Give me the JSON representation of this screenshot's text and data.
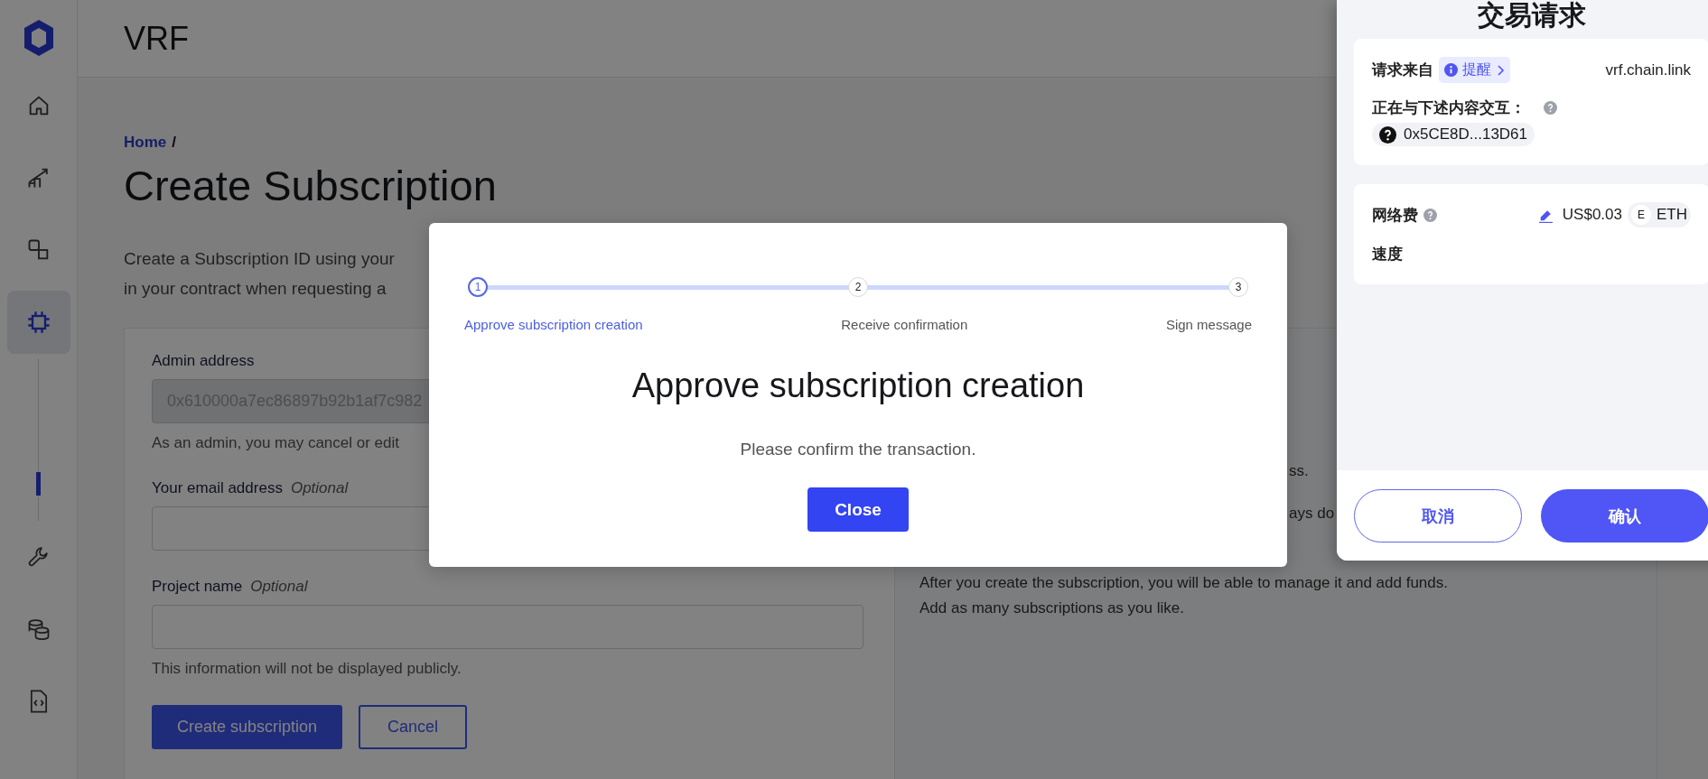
{
  "sidebar": {
    "items": [
      {
        "selected": false
      },
      {
        "selected": false
      },
      {
        "selected": false
      },
      {
        "selected": true
      },
      {
        "selected": false
      },
      {
        "selected": false
      },
      {
        "selected": false
      }
    ]
  },
  "header": {
    "title": "VRF"
  },
  "breadcrumb": {
    "link": "Home",
    "separator": "/"
  },
  "page_title": "Create Subscription",
  "intro": [
    "Create a Subscription ID using your",
    "in your contract when requesting a"
  ],
  "form": {
    "fields": [
      {
        "label": "Admin address",
        "value": "0x610000a7ec86897b92b1af7c982",
        "disabled": true,
        "help": "As an admin, you may cancel or edit"
      },
      {
        "label": "Your email address",
        "optional": "Optional",
        "disabled": false
      },
      {
        "label": "Project name",
        "optional": "Optional",
        "disabled": false,
        "help": "This information will not be displayed publicly."
      }
    ],
    "buttons": [
      {
        "label": "Create subscription",
        "kind": "primary"
      },
      {
        "label": "Cancel",
        "kind": "secondary"
      }
    ]
  },
  "info_panel": {
    "partial_lines": [
      "ss.",
      "ays do"
    ],
    "lines": [
      "After you create the subscription, you will be able to manage it and add funds.",
      "Add as many subscriptions as you like."
    ]
  },
  "modal": {
    "steps": [
      {
        "number": "1",
        "label": "Approve subscription creation",
        "selected": true
      },
      {
        "number": "2",
        "label": "Receive confirmation",
        "selected": false
      },
      {
        "number": "3",
        "label": "Sign message",
        "selected": false
      }
    ],
    "heading": "Approve subscription creation",
    "message": "Please confirm the transaction.",
    "button": "Close"
  },
  "wallet": {
    "title": "交易请求",
    "request_from": {
      "label": "请求来自",
      "badge": "提醒",
      "origin": "vrf.chain.link"
    },
    "interacting": {
      "label": "正在与下述内容交互：",
      "address": "0x5CE8D...13D61"
    },
    "fee": {
      "label": "网络费",
      "amount": "US$0.03",
      "token_icon": "E",
      "token": "ETH"
    },
    "speed": {
      "label": "速度"
    },
    "buttons": [
      {
        "label": "取消",
        "kind": "secondary"
      },
      {
        "label": "确认",
        "kind": "primary"
      }
    ]
  }
}
